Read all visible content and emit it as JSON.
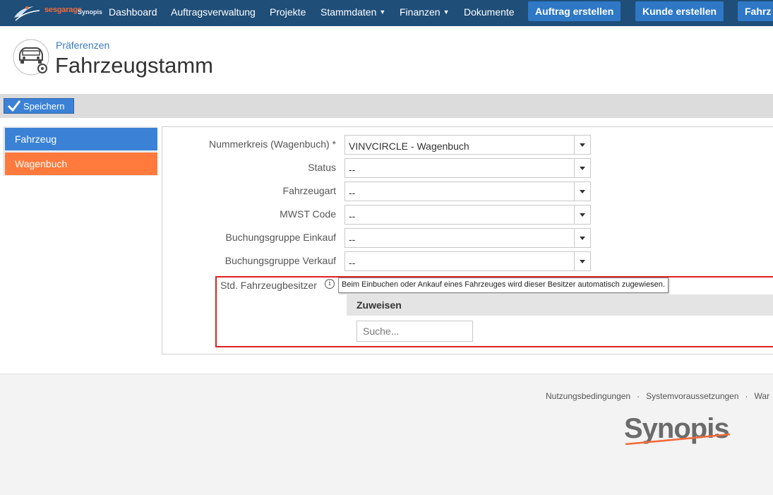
{
  "nav": {
    "brand": "sesgarage",
    "brand_sub": "Synopis",
    "items": [
      {
        "label": "Dashboard"
      },
      {
        "label": "Auftragsverwaltung"
      },
      {
        "label": "Projekte"
      },
      {
        "label": "Stammdaten",
        "dropdown": true
      },
      {
        "label": "Finanzen",
        "dropdown": true
      },
      {
        "label": "Dokumente"
      }
    ],
    "buttons": [
      {
        "label": "Auftrag erstellen"
      },
      {
        "label": "Kunde erstellen"
      },
      {
        "label": "Fahrz"
      }
    ]
  },
  "header": {
    "breadcrumb": "Präferenzen",
    "title": "Fahrzeugstamm"
  },
  "toolbar": {
    "save_label": "Speichern"
  },
  "sidebar": {
    "items": [
      {
        "label": "Fahrzeug",
        "color": "#3b82d6"
      },
      {
        "label": "Wagenbuch",
        "color": "#ff7a3c"
      }
    ]
  },
  "form": {
    "fields": [
      {
        "label": "Nummerkreis (Wagenbuch) *",
        "value": "VINVCIRCLE - Wagenbuch"
      },
      {
        "label": "Status",
        "value": "--"
      },
      {
        "label": "Fahrzeugart",
        "value": "--"
      },
      {
        "label": "MWST Code",
        "value": "--"
      },
      {
        "label": "Buchungsgruppe Einkauf",
        "value": "--"
      },
      {
        "label": "Buchungsgruppe Verkauf",
        "value": "--"
      }
    ],
    "owner": {
      "label": "Std. Fahrzeugbesitzer",
      "info_icon": "info-icon",
      "tooltip": "Beim Einbuchen oder Ankauf eines Fahrzeuges wird dieser Besitzer automatisch zugewiesen.",
      "assign_label": "Zuweisen",
      "search_placeholder": "Suche..."
    }
  },
  "footer": {
    "links": [
      "Nutzungsbedingungen",
      "Systemvoraussetzungen",
      "War"
    ],
    "logo": "Synopis"
  },
  "colors": {
    "nav_bg": "#1f4e79",
    "button_blue": "#2e78c6",
    "accent_orange": "#ff7a3c",
    "highlight_border": "#e02020"
  }
}
